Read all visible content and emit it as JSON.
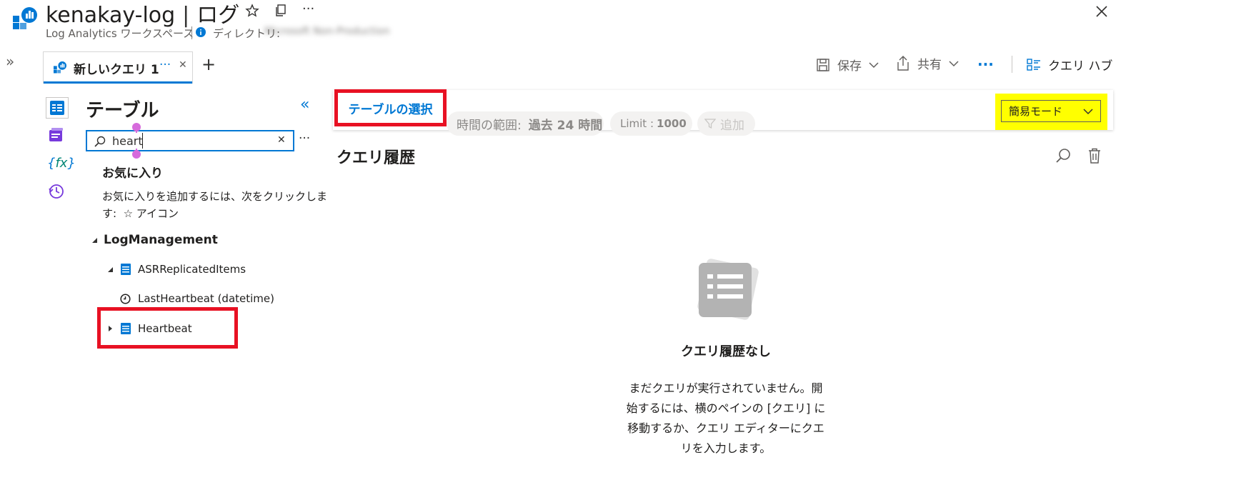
{
  "header": {
    "title": "kenakay-log",
    "section": "ログ",
    "subtitle": "Log Analytics ワークスペース",
    "directory_label": "ディレクトリ:",
    "directory_value": "Microsoft Non-Production",
    "more": "···",
    "close": "✕"
  },
  "tabs": {
    "expand": "»",
    "active_tab": "新しいクエリ 1",
    "tab_more": "···",
    "tab_close": "✕",
    "add": "+"
  },
  "toolbar": {
    "save": "保存",
    "share": "共有",
    "more": "···",
    "query_hub": "クエリ ハブ"
  },
  "sidebar": {
    "title": "テーブル",
    "collapse": "«",
    "search_value": "heart",
    "search_clear": "✕",
    "search_more": "···",
    "favorites_title": "お気に入り",
    "favorites_hint_line1": "お気に入りを追加するには、次をクリックしま",
    "favorites_hint_line2": "す:  ☆ アイコン",
    "tree": {
      "group": "LogManagement",
      "table1": "ASRReplicatedItems",
      "column1": "LastHeartbeat (datetime)",
      "table2": "Heartbeat"
    }
  },
  "query_bar": {
    "select_table": "テーブルの選択",
    "time_range_label": "時間の範囲:",
    "time_range_value": "過去 24 時間",
    "limit_label": "Limit :",
    "limit_value": "1000",
    "add_filter": "追加",
    "mode": "簡易モード"
  },
  "history": {
    "title": "クエリ履歴",
    "empty_title": "クエリ履歴なし",
    "empty_line1": "まだクエリが実行されていません。開",
    "empty_line2": "始するには、横のペインの [クエリ] に",
    "empty_line3": "移動するか、クエリ エディターにクエ",
    "empty_line4": "リを入力します。"
  },
  "colors": {
    "accent": "#0078d4",
    "highlight_red": "#e81123",
    "highlight_yellow": "#ffff00",
    "pill_bg": "#f3f2f1",
    "empty_icon": "#b3b3b3"
  }
}
